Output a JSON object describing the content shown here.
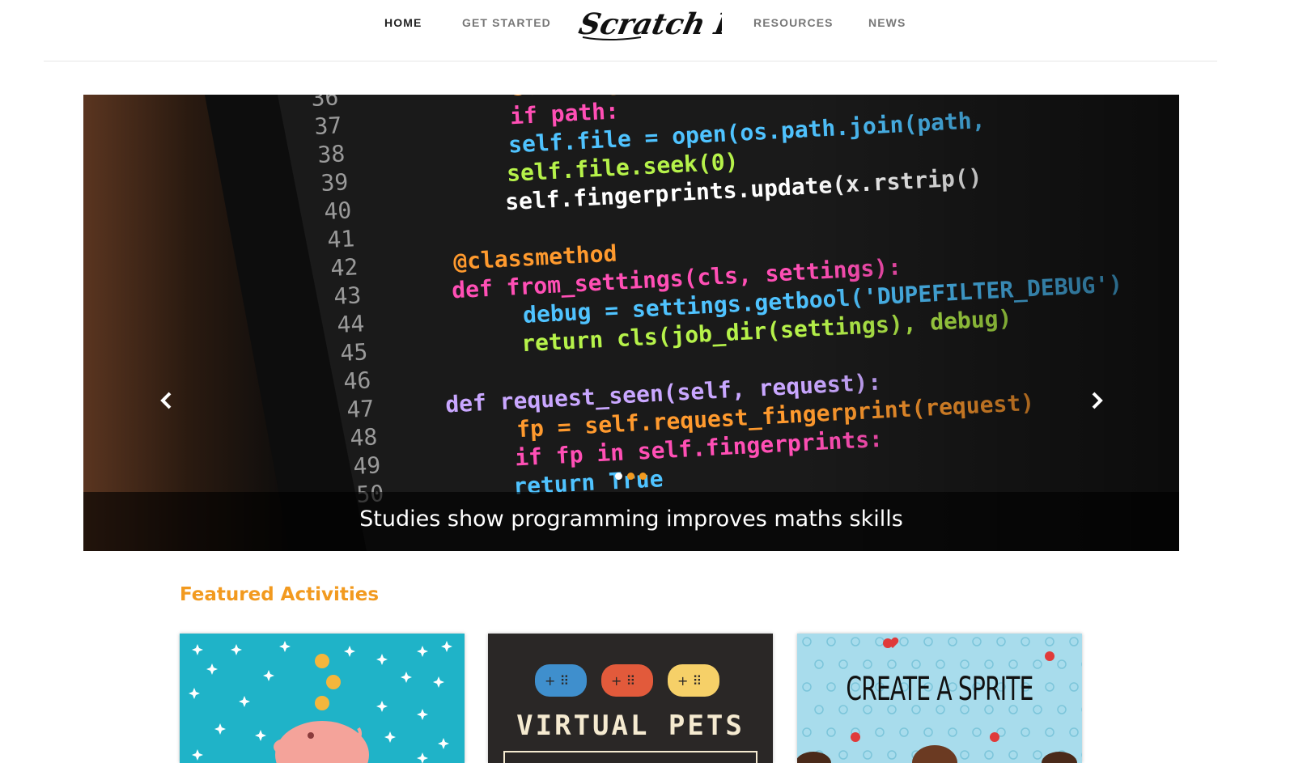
{
  "nav": {
    "items": [
      {
        "label": "HOME",
        "active": true
      },
      {
        "label": "GET STARTED",
        "active": false
      },
      {
        "label": "RESOURCES",
        "active": false
      },
      {
        "label": "NEWS",
        "active": false
      }
    ],
    "logo_text": "Scratch Post"
  },
  "carousel": {
    "caption": "Studies show programming improves maths skills",
    "slide_count": 3,
    "active_index": 0,
    "dot_colors": [
      "#ffffff",
      "#f29a1f",
      "#f29a1f"
    ],
    "code_lines": [
      {
        "num": "36",
        "text": "self.logger"
      },
      {
        "num": "37",
        "text": "if path:"
      },
      {
        "num": "38",
        "text": "self.file = open(os.path.join(path,"
      },
      {
        "num": "39",
        "text": "self.file.seek(0)"
      },
      {
        "num": "40",
        "text": "self.fingerprints.update(x.rstrip()"
      },
      {
        "num": "41",
        "text": ""
      },
      {
        "num": "42",
        "text": "@classmethod"
      },
      {
        "num": "43",
        "text": "def from_settings(cls, settings):"
      },
      {
        "num": "44",
        "text": "debug = settings.getbool('DUPEFILTER_DEBUG')"
      },
      {
        "num": "45",
        "text": "return cls(job_dir(settings), debug)"
      },
      {
        "num": "46",
        "text": ""
      },
      {
        "num": "47",
        "text": "def request_seen(self, request):"
      },
      {
        "num": "48",
        "text": "fp = self.request_fingerprint(request)"
      },
      {
        "num": "49",
        "text": "if fp in self.fingerprints:"
      },
      {
        "num": "50",
        "text": "return True"
      }
    ]
  },
  "featured": {
    "title": "Featured Activities",
    "cards": [
      {
        "label": "",
        "bg": "#1fb3c8"
      },
      {
        "label": "VIRTUAL PETS",
        "bg": "#2a2726"
      },
      {
        "label": "CREATE A SPRITE",
        "bg": "#a8dcec"
      }
    ]
  },
  "colors": {
    "accent": "#f29a1f",
    "nav_active": "#222222",
    "nav_inactive": "#777777"
  }
}
